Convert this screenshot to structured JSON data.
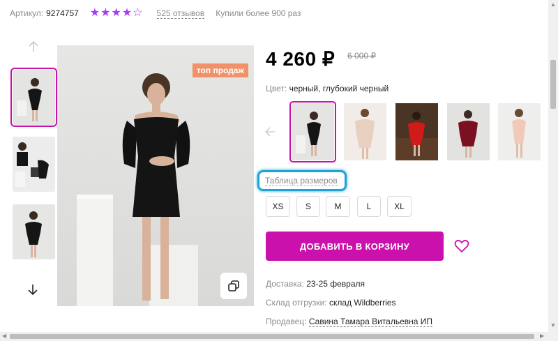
{
  "top": {
    "article_label": "Артикул:",
    "article_value": "9274757",
    "rating_stars": 4,
    "reviews": "525 отзывов",
    "bought": "Купили более 900 раз"
  },
  "gallery": {
    "badge": "топ продаж",
    "thumbnails_count": 3,
    "active_thumbnail": 0
  },
  "price": {
    "current": "4 260 ₽",
    "old": "6 000 ₽"
  },
  "color": {
    "label": "Цвет:",
    "value": "черный, глубокий черный",
    "options_count": 5,
    "active_option": 0
  },
  "sizes": {
    "table_link": "Таблица размеров",
    "options": [
      "XS",
      "S",
      "M",
      "L",
      "XL"
    ]
  },
  "cart": {
    "button": "ДОБАВИТЬ В КОРЗИНУ"
  },
  "details": {
    "delivery_label": "Доставка:",
    "delivery_value": "23-25 февраля",
    "warehouse_label": "Склад отгрузки:",
    "warehouse_value": "склад Wildberries",
    "seller_label": "Продавец:",
    "seller_value": "Савина Тамара Витальевна ИП"
  },
  "colors": {
    "accent": "#cb11ab",
    "star": "#a73afd",
    "highlight": "#1fa2d6"
  }
}
